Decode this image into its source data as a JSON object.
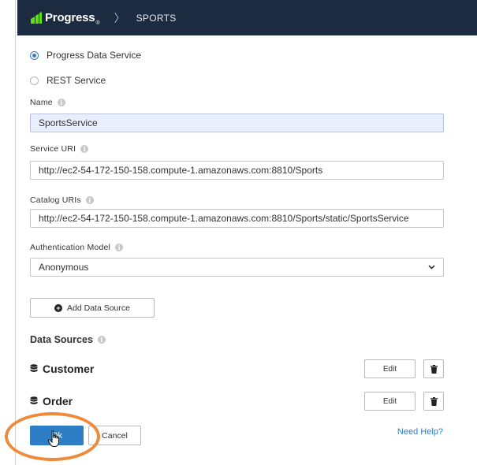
{
  "header": {
    "logo_text": "Progress",
    "logo_tm": "®",
    "separator": "〉",
    "breadcrumb": "SPORTS"
  },
  "service_type": {
    "options": [
      {
        "label": "Progress Data Service",
        "selected": true
      },
      {
        "label": "REST Service",
        "selected": false
      }
    ]
  },
  "form": {
    "name_label": "Name",
    "name_value": "SportsService",
    "service_uri_label": "Service URI",
    "service_uri_value": "http://ec2-54-172-150-158.compute-1.amazonaws.com:8810/Sports",
    "catalog_uris_label": "Catalog URIs",
    "catalog_uris_value": "http://ec2-54-172-150-158.compute-1.amazonaws.com:8810/Sports/static/SportsService",
    "auth_model_label": "Authentication Model",
    "auth_model_value": "Anonymous",
    "info_glyph": "i"
  },
  "data_sources": {
    "add_button_label": "Add Data Source",
    "add_icon_glyph": "+",
    "section_title": "Data Sources",
    "items": [
      {
        "name": "Customer",
        "edit_label": "Edit"
      },
      {
        "name": "Order",
        "edit_label": "Edit"
      }
    ]
  },
  "footer": {
    "ok_label": "Ok",
    "cancel_label": "Cancel",
    "help_label": "Need Help?"
  },
  "colors": {
    "header_bg": "#1c2b3f",
    "logo_green": "#5ce500",
    "primary_blue": "#2d7ec4",
    "highlight_orange": "#ee8a3a",
    "focused_input_bg": "#e8eefc"
  },
  "icons": {
    "logo": "progress-logo-icon",
    "info": "info-icon",
    "dropdown": "chevron-down-icon",
    "add": "plus-circle-icon",
    "database": "database-icon",
    "delete": "trash-icon",
    "pointer": "hand-pointer-icon"
  }
}
